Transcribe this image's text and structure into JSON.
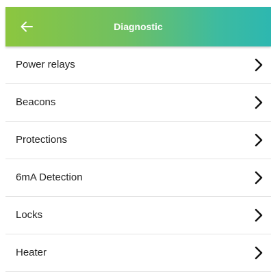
{
  "header": {
    "title": "Diagnostic",
    "back_icon": "arrow-left-icon",
    "gradient_start": "#8cc63f",
    "gradient_end": "#2db7b0"
  },
  "menu": {
    "chevron_icon": "chevron-right-icon",
    "items": [
      {
        "label": "Power relays"
      },
      {
        "label": "Beacons"
      },
      {
        "label": "Protections"
      },
      {
        "label": "6mA Detection"
      },
      {
        "label": "Locks"
      },
      {
        "label": "Heater"
      }
    ]
  }
}
